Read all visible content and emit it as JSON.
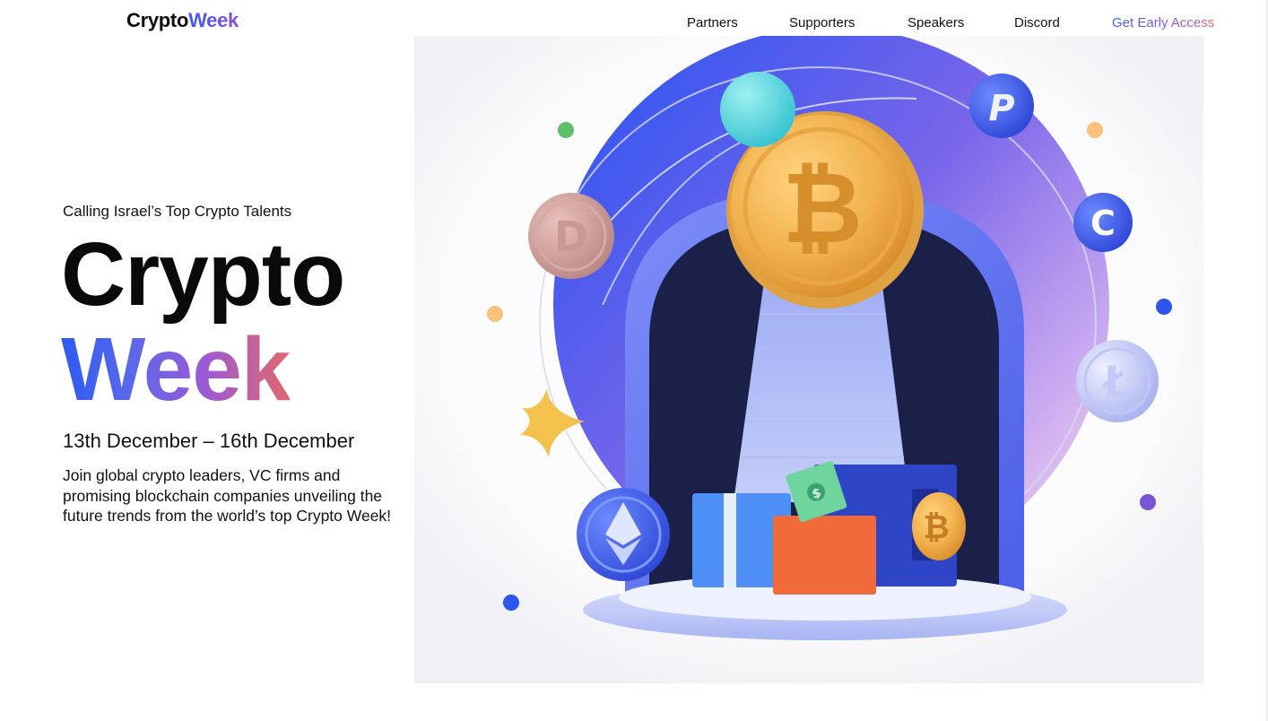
{
  "header": {
    "logo_part1": "Crypto",
    "logo_part2": "Week",
    "nav": {
      "partners": "Partners",
      "supporters": "Supporters",
      "speakers": "Speakers",
      "discord": "Discord",
      "cta": "Get Early Access"
    }
  },
  "hero": {
    "tagline": "Calling Israel’s Top Crypto Talents",
    "title_line1": "Crypto",
    "title_line2": "Week",
    "dates": "13th December – 16th December",
    "description": "Join global crypto leaders, VC firms and promising blockchain companies unveiling the future trends from the world’s top Crypto Week!",
    "illustration": {
      "main_coin_symbol": "₿",
      "coin_symbols": [
        "D",
        "P",
        "C",
        "Ł",
        "₿",
        "$"
      ],
      "icons": [
        "bitcoin-coin-icon",
        "dogecoin-coin-icon",
        "paypal-coin-icon",
        "c-coin-icon",
        "litecoin-coin-icon",
        "ethereum-coin-icon",
        "star-icon",
        "dollar-bill-icon"
      ]
    }
  },
  "colors": {
    "accent_blue": "#2d5bf0",
    "accent_purple": "#9a5ad8",
    "accent_coral": "#e0676f",
    "coin_gold": "#f2b54c"
  }
}
